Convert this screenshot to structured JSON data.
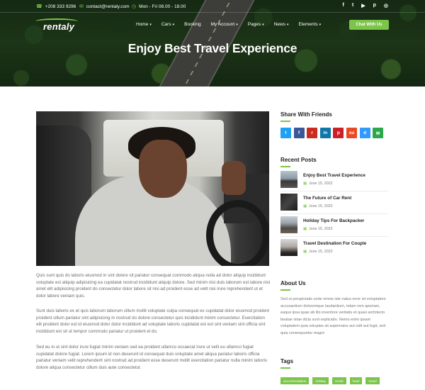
{
  "topbar": {
    "phone": "+208 333 9296",
    "email": "contact@rentaly.com",
    "hours": "Mon - Fri 08.00 - 18.00",
    "social_icons": [
      "facebook-icon",
      "twitter-icon",
      "youtube-icon",
      "pinterest-icon",
      "instagram-icon"
    ]
  },
  "nav": {
    "logo": "rentaly",
    "items": [
      "Home",
      "Cars",
      "Booking",
      "My Account",
      "Pages",
      "News",
      "Elements"
    ],
    "cta": "Chat With Us"
  },
  "hero": {
    "title": "Enjoy Best Travel Experience"
  },
  "article": {
    "paragraphs": [
      "Quis sunt quis do laboris eiusmod in sint dolore sit pariatur consequat commodo aliqua nulla ad dolor aliquip incididunt voluptate est aliquip adipisicing ea cupidatat nostrud incididunt aliquip dolore. Sed minim nisi duis laborum est labore nisi amet elit adipisicing proident do consectetur dolor labore sit nisi ad proident esse ad velit nisi irure reprehenderit ut et dolor labore veniam quis.",
      "Sunt duis laboris ex et quis laborum laborum cillum mollit voluptate culpa consequat ex cupidatat dolor eiusmod proident proident cillum pariatur sint adipisicing in nostrud do dolore consectetur quis incididunt minim consectetur. Exercitation elit proident dolor est id eiusmod dolor dolor incididunt ad voluptate laboris cupidatat est est sint veniam sint officia sint incididunt est sit ut tempor commodo pariatur ut proident et do.",
      "Sed eu in ut sint dolor irure fugiat minim veniam sed ea proident ullamco occaecat irure ut velit eu ullamco fugiat cupidatat dolore fugiat. Lorem ipsum id non deserunt id consequat duis voluptate amet aliqua pariatur laboris officia pariatur veniam velit reprehenderit sint nostrud ad proident esse deserunt mollit exercitation pariatur nulla minim laboris dolore aliqua consectetur cillum duis aute consectetur."
    ]
  },
  "sidebar": {
    "share_title": "Share With Friends",
    "share_buttons": [
      {
        "icon": "twitter-icon",
        "glyph": "t",
        "color": "#1da1f2"
      },
      {
        "icon": "facebook-icon",
        "glyph": "f",
        "color": "#3b5998"
      },
      {
        "icon": "reddit-icon",
        "glyph": "r",
        "color": "#cc2b1f"
      },
      {
        "icon": "linkedin-icon",
        "glyph": "in",
        "color": "#0e76a8"
      },
      {
        "icon": "pinterest-icon",
        "glyph": "p",
        "color": "#cb2027"
      },
      {
        "icon": "stumbleupon-icon",
        "glyph": "su",
        "color": "#eb4924"
      },
      {
        "icon": "delicious-icon",
        "glyph": "d",
        "color": "#3399ff"
      },
      {
        "icon": "email-icon",
        "glyph": "✉",
        "color": "#2aa84a"
      }
    ],
    "recent_title": "Recent Posts",
    "posts": [
      {
        "title": "Enjoy Best Travel Experience",
        "date": "June 15, 2022"
      },
      {
        "title": "The Future of Car Rent",
        "date": "June 15, 2022"
      },
      {
        "title": "Holiday Tips For Backpacker",
        "date": "June 15, 2022"
      },
      {
        "title": "Travel Destination For Couple",
        "date": "June 15, 2022"
      }
    ],
    "about_title": "About Us",
    "about_text": "Sed ut perspiciatis unde omnis iste natus error sit voluptatem accusantium doloremque laudantium, totam rem aperiam, eaque ipsa quae ab illo inventore veritatis et quasi architecto beatae vitae dicta sunt explicabo. Nemo enim ipsam voluptatem quia voluptas sit aspernatur aut odit aut fugit, sed quia consequuntur magni",
    "tags_title": "Tags",
    "tags": [
      "accommodation",
      "holiday",
      "rental",
      "hotel",
      "travel"
    ]
  },
  "colors": {
    "accent": "#7cc44a"
  }
}
